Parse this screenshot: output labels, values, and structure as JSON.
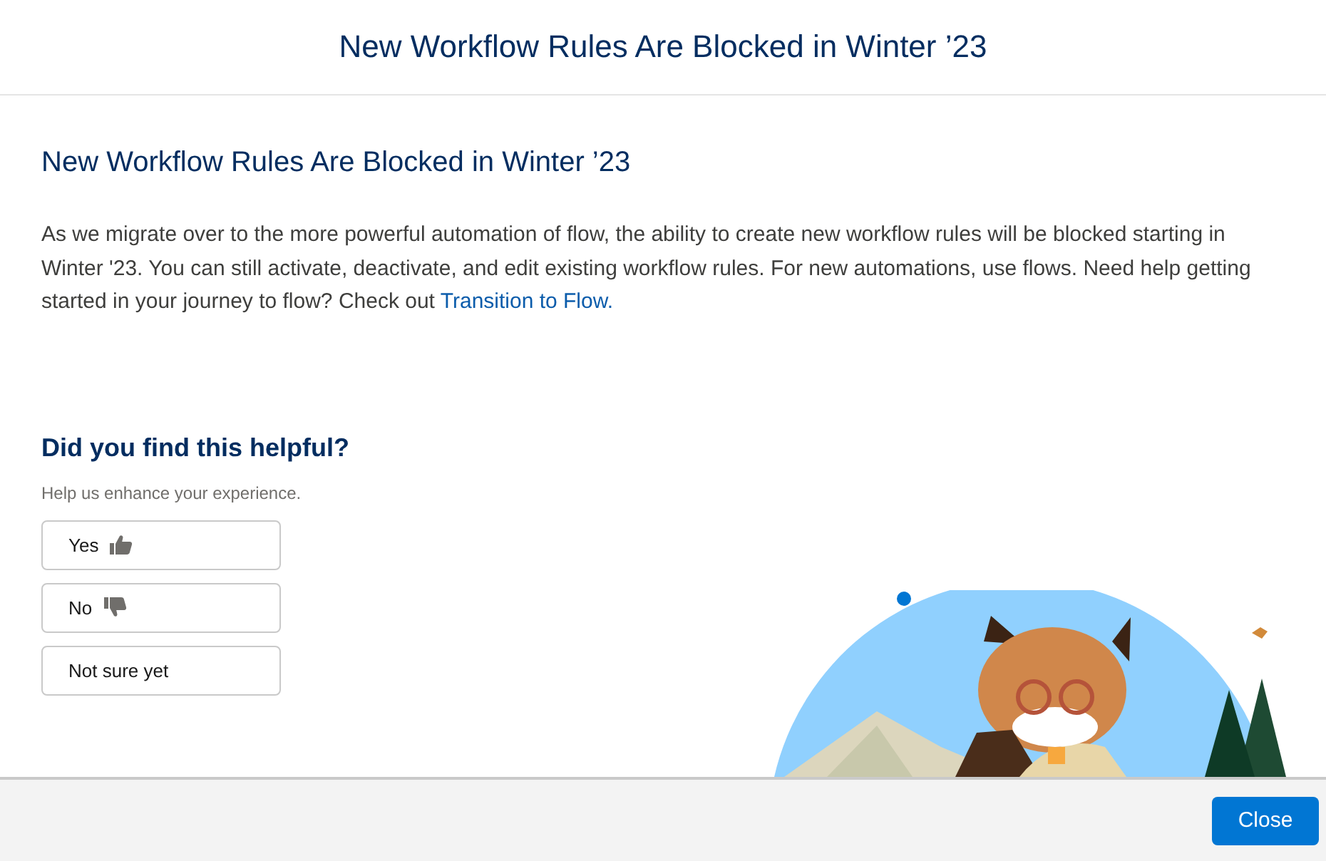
{
  "window": {
    "title": "New Workflow Rules Are Blocked in Winter ’23"
  },
  "article": {
    "heading": "New Workflow Rules Are Blocked in Winter ’23",
    "paragraph": "As we migrate over to the more powerful automation of flow, the ability to create new workflow rules will be blocked starting in Winter '23. You can still activate, deactivate, and edit existing workflow rules. For new automations, use flows. Need help getting started in your journey to flow? Check out",
    "link": "Transition to Flow."
  },
  "feedback": {
    "title": "Did you find this helpful?",
    "hint": "Help us enhance your experience.",
    "options": [
      {
        "label": "Yes",
        "kind": "thumbs_up"
      },
      {
        "label": "No",
        "kind": "thumbs_down"
      },
      {
        "label": "Not sure yet",
        "kind": "plain"
      }
    ]
  },
  "footer": {
    "button": "Close"
  }
}
